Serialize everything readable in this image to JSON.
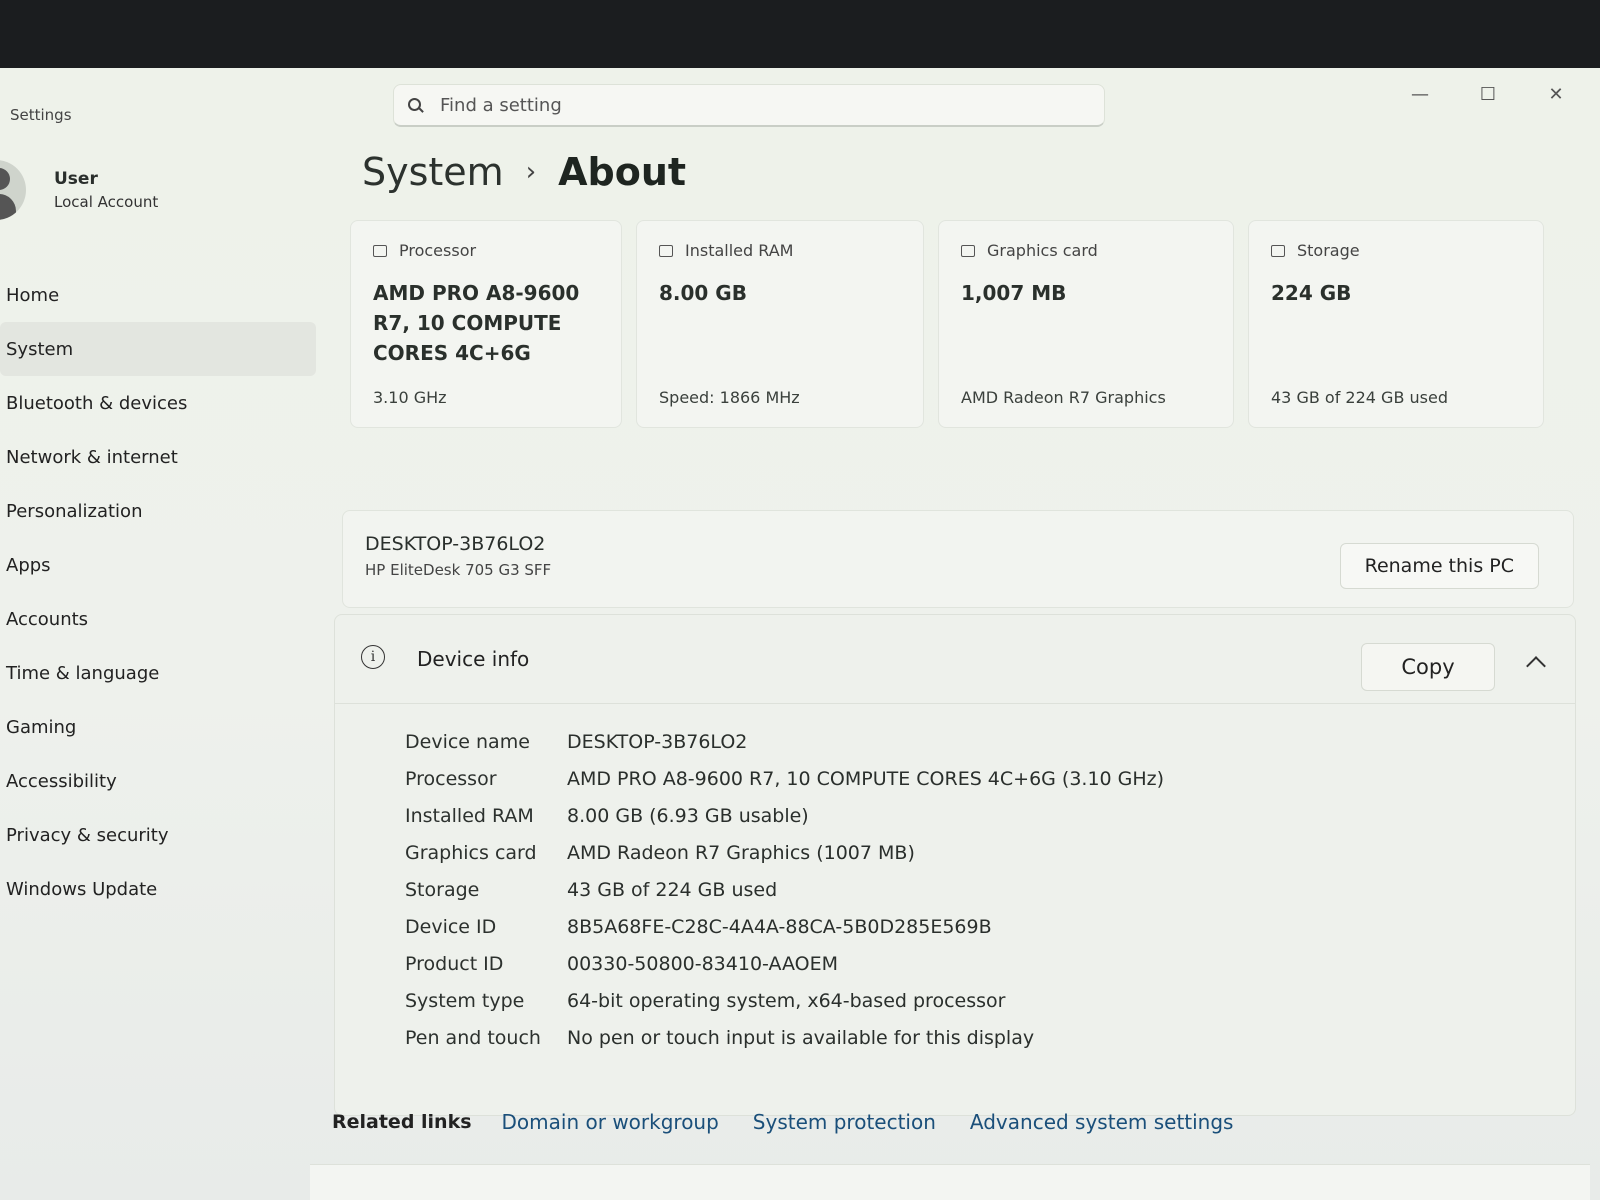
{
  "window": {
    "app_title": "Settings",
    "controls": {
      "minimize": "—",
      "maximize": "☐",
      "close": "✕"
    }
  },
  "search": {
    "placeholder": "Find a setting",
    "value": "",
    "icon": "search-icon"
  },
  "user": {
    "name": "User",
    "account_type": "Local Account"
  },
  "sidebar": {
    "items": [
      {
        "label": "Home",
        "active": false
      },
      {
        "label": "System",
        "active": true
      },
      {
        "label": "Bluetooth & devices",
        "active": false
      },
      {
        "label": "Network & internet",
        "active": false
      },
      {
        "label": "Personalization",
        "active": false
      },
      {
        "label": "Apps",
        "active": false
      },
      {
        "label": "Accounts",
        "active": false
      },
      {
        "label": "Time & language",
        "active": false
      },
      {
        "label": "Gaming",
        "active": false
      },
      {
        "label": "Accessibility",
        "active": false
      },
      {
        "label": "Privacy & security",
        "active": false
      },
      {
        "label": "Windows Update",
        "active": false
      }
    ]
  },
  "breadcrumb": {
    "parent": "System",
    "separator": "›",
    "current": "About"
  },
  "cards": [
    {
      "title": "Processor",
      "icon": "processor-icon",
      "value": "AMD PRO A8-9600 R7, 10 COMPUTE CORES 4C+6G",
      "sub": "3.10 GHz"
    },
    {
      "title": "Installed RAM",
      "icon": "ram-icon",
      "value": "8.00 GB",
      "sub": "Speed: 1866 MHz"
    },
    {
      "title": "Graphics card",
      "icon": "graphics-card-icon",
      "value": "1,007 MB",
      "sub": "AMD Radeon R7 Graphics"
    },
    {
      "title": "Storage",
      "icon": "storage-icon",
      "value": "224 GB",
      "sub": "43 GB of 224 GB used"
    }
  ],
  "pc": {
    "name": "DESKTOP-3B76LO2",
    "model": "HP EliteDesk 705 G3 SFF",
    "rename_label": "Rename this PC"
  },
  "device_info": {
    "title": "Device info",
    "copy_label": "Copy",
    "specs": [
      {
        "label": "Device name",
        "value": "DESKTOP-3B76LO2"
      },
      {
        "label": "Processor",
        "value": "AMD PRO A8-9600 R7, 10 COMPUTE CORES 4C+6G (3.10 GHz)"
      },
      {
        "label": "Installed RAM",
        "value": "8.00 GB (6.93 GB usable)"
      },
      {
        "label": "Graphics card",
        "value": "AMD Radeon R7 Graphics (1007 MB)"
      },
      {
        "label": "Storage",
        "value": "43 GB of 224 GB used"
      },
      {
        "label": "Device ID",
        "value": "8B5A68FE-C28C-4A4A-88CA-5B0D285E569B"
      },
      {
        "label": "Product ID",
        "value": "00330-50800-83410-AAOEM"
      },
      {
        "label": "System type",
        "value": "64-bit operating system, x64-based processor"
      },
      {
        "label": "Pen and touch",
        "value": "No pen or touch input is available for this display"
      }
    ]
  },
  "related_links": {
    "label": "Related links",
    "links": [
      "Domain or workgroup",
      "System protection",
      "Advanced system settings"
    ]
  }
}
